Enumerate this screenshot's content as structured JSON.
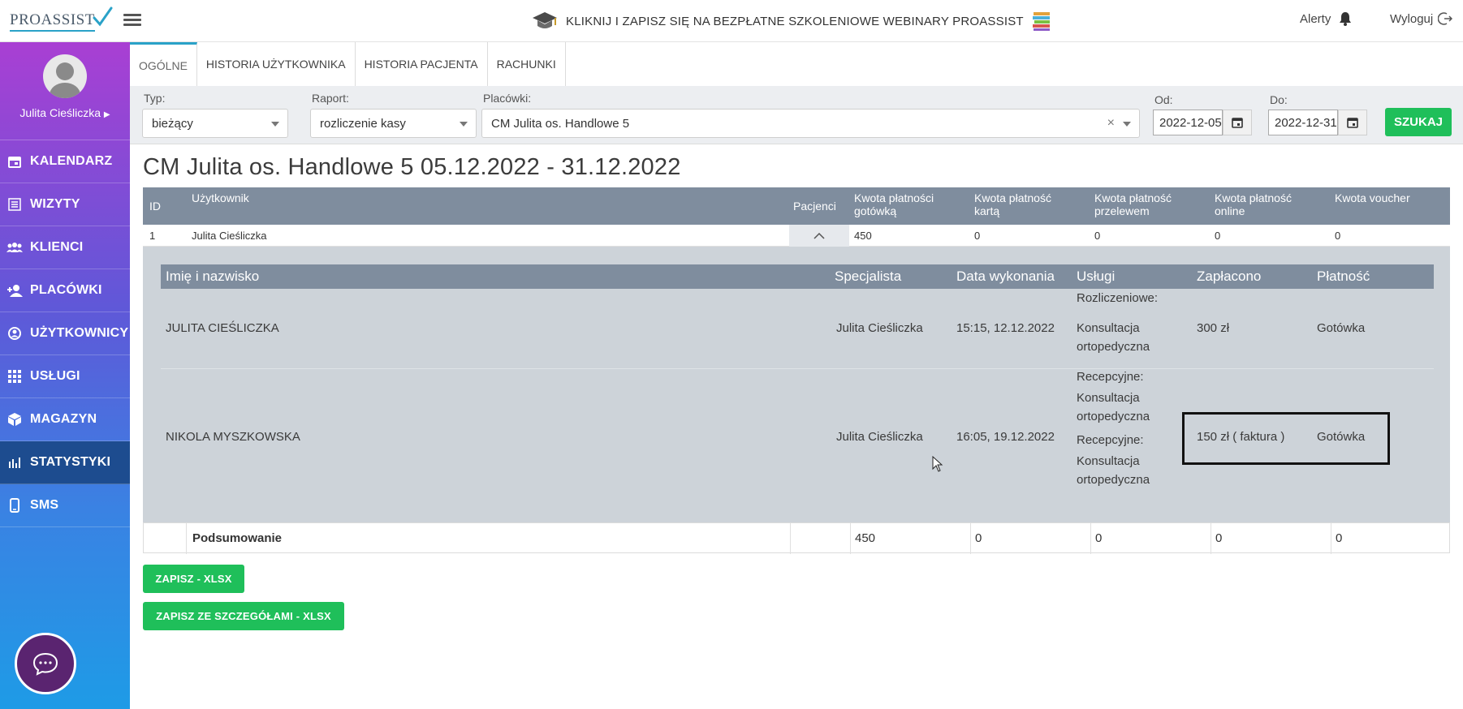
{
  "header": {
    "logo_text": "PROASSIST",
    "promo_text": "KLIKNIJ I ZAPISZ SIĘ NA BEZPŁATNE SZKOLENIOWE WEBINARY PROASSIST",
    "alerts_label": "Alerty",
    "logout_label": "Wyloguj"
  },
  "sidebar": {
    "user_name": "Julita Cieśliczka",
    "items": [
      {
        "label": "KALENDARZ",
        "icon": "calendar-icon"
      },
      {
        "label": "WIZYTY",
        "icon": "list-icon"
      },
      {
        "label": "KLIENCI",
        "icon": "users-icon"
      },
      {
        "label": "PLACÓWKI",
        "icon": "user-plus-icon"
      },
      {
        "label": "UŻYTKOWNICY",
        "icon": "user-circle-icon"
      },
      {
        "label": "USŁUGI",
        "icon": "grid-icon"
      },
      {
        "label": "MAGAZYN",
        "icon": "box-icon"
      },
      {
        "label": "STATYSTYKI",
        "icon": "bar-chart-icon"
      },
      {
        "label": "SMS",
        "icon": "phone-icon"
      }
    ],
    "active_index": 7
  },
  "tabs": [
    "OGÓLNE",
    "HISTORIA UŻYTKOWNIKA",
    "HISTORIA PACJENTA",
    "RACHUNKI"
  ],
  "filters": {
    "typ_label": "Typ:",
    "typ_value": "bieżący",
    "raport_label": "Raport:",
    "raport_value": "rozliczenie kasy",
    "placowki_label": "Placówki:",
    "placowki_value": "CM Julita os. Handlowe 5",
    "od_label": "Od:",
    "od_value": "2022-12-05",
    "do_label": "Do:",
    "do_value": "2022-12-31",
    "search_label": "SZUKAJ"
  },
  "report_title": "CM Julita os. Handlowe 5 05.12.2022 - 31.12.2022",
  "table": {
    "headers": {
      "id": "ID",
      "user": "Użytkownik",
      "patients": "Pacjenci",
      "cash_1": "Kwota płatności",
      "cash_2": "gotówką",
      "card_1": "Kwota płatność",
      "card_2": "kartą",
      "transfer_1": "Kwota płatność",
      "transfer_2": "przelewem",
      "online_1": "Kwota płatność",
      "online_2": "online",
      "voucher": "Kwota voucher"
    },
    "row": {
      "id": "1",
      "user": "Julita Cieśliczka",
      "cash": "450",
      "card": "0",
      "transfer": "0",
      "online": "0",
      "voucher": "0"
    },
    "details": {
      "headers": {
        "name": "Imię i nazwisko",
        "specialist": "Specjalista",
        "date": "Data wykonania",
        "services": "Usługi",
        "paid": "Zapłacono",
        "payment": "Płatność"
      },
      "entries": [
        {
          "name": "JULITA CIEŚLICZKA",
          "specialist": "Julita Cieśliczka",
          "date": "15:15, 12.12.2022",
          "services": [
            "Rozliczeniowe:",
            "Konsultacja",
            "ortopedyczna"
          ],
          "paid": "300 zł",
          "payment": "Gotówka"
        },
        {
          "name": "NIKOLA MYSZKOWSKA",
          "specialist": "Julita Cieśliczka",
          "date": "16:05, 19.12.2022",
          "services": [
            "Recepcyjne:",
            "Konsultacja",
            "ortopedyczna",
            "Recepcyjne:",
            "Konsultacja",
            "ortopedyczna"
          ],
          "paid": "150 zł ( faktura )",
          "payment": "Gotówka"
        }
      ]
    },
    "summary": {
      "label": "Podsumowanie",
      "cash": "450",
      "card": "0",
      "transfer": "0",
      "online": "0",
      "voucher": "0"
    }
  },
  "buttons": {
    "save_xlsx": "ZAPISZ - XLSX",
    "save_details_xlsx": "ZAPISZ ZE SZCZEGÓŁAMI - XLSX"
  },
  "colors": {
    "accent_green": "#1fbf5a",
    "table_header": "#7f8d9e",
    "sidebar_active": "#1d4c8f"
  }
}
